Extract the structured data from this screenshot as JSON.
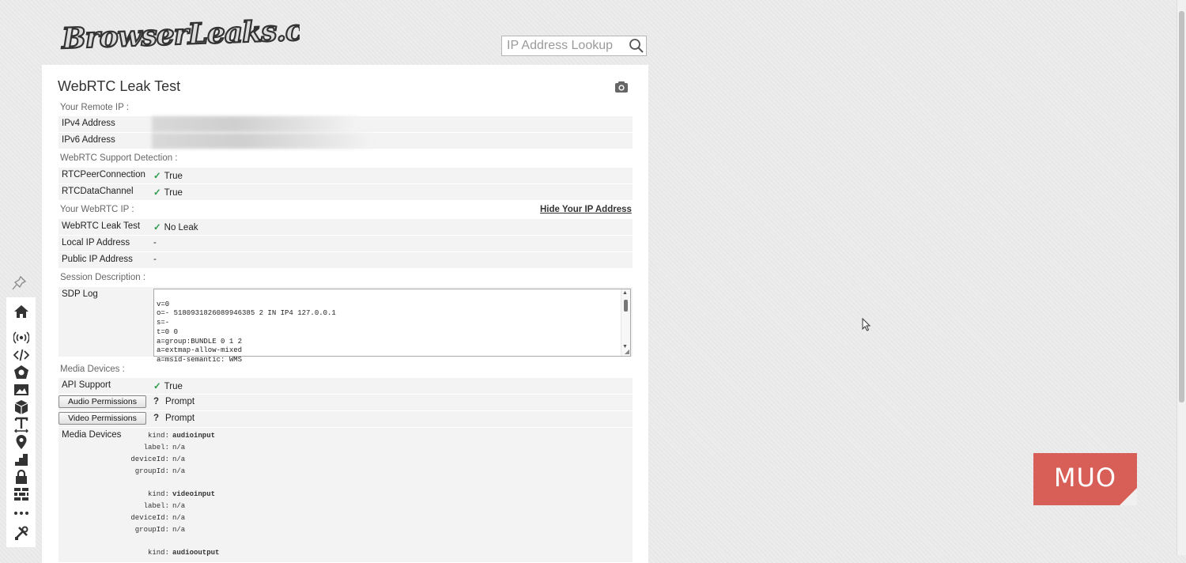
{
  "logo": {
    "text": "BrowserLeaks.com"
  },
  "search": {
    "placeholder": "IP Address Lookup",
    "icon": "search-icon"
  },
  "page": {
    "title": "WebRTC Leak Test",
    "screenshot_icon": "camera-icon"
  },
  "sections": {
    "remote_ip": "Your Remote IP :",
    "support": "WebRTC Support Detection :",
    "webrtc_ip": "Your WebRTC IP :",
    "session": "Session Description :",
    "media": "Media Devices :"
  },
  "remote_ip": {
    "ipv4_label": "IPv4 Address",
    "ipv6_label": "IPv6 Address"
  },
  "support": [
    {
      "label": "RTCPeerConnection",
      "value": "True"
    },
    {
      "label": "RTCDataChannel",
      "value": "True"
    }
  ],
  "hide_link": "Hide Your IP Address",
  "webrtc_ip": {
    "leak_label": "WebRTC Leak Test",
    "leak_value": "No Leak",
    "local_label": "Local IP Address",
    "local_value": "-",
    "public_label": "Public IP Address",
    "public_value": "-"
  },
  "sdp": {
    "label": "SDP Log",
    "lines": [
      "v=0",
      "o=- 5180931826089946385 2 IN IP4 127.0.0.1",
      "s=-",
      "t=0 0",
      "a=group:BUNDLE 0 1 2",
      "a=extmap-allow-mixed",
      "a=msid-semantic: WMS"
    ]
  },
  "media": {
    "api_label": "API Support",
    "api_value": "True",
    "audio_button": "Audio Permissions",
    "audio_value": "Prompt",
    "video_button": "Video Permissions",
    "video_value": "Prompt",
    "devices_label": "Media Devices",
    "devices": [
      {
        "kind": "audioinput",
        "label": "n/a",
        "deviceId": "n/a",
        "groupId": "n/a"
      },
      {
        "kind": "videoinput",
        "label": "n/a",
        "deviceId": "n/a",
        "groupId": "n/a"
      },
      {
        "kind": "audiooutput"
      }
    ],
    "keys": {
      "kind": "kind:",
      "label": "label:",
      "deviceId": "deviceId:",
      "groupId": "groupId:"
    }
  },
  "sidebar": {
    "icons": [
      "home-icon",
      "broadcast-icon",
      "code-icon",
      "puzzle-icon",
      "image-icon",
      "cube-icon",
      "text-icon",
      "location-icon",
      "chart-icon",
      "lock-icon",
      "firewall-icon",
      "more-icon",
      "tools-icon"
    ]
  },
  "watermark": {
    "text": "MUO"
  },
  "colors": {
    "check": "#2e9a4a",
    "watermark": "#d85f57"
  }
}
